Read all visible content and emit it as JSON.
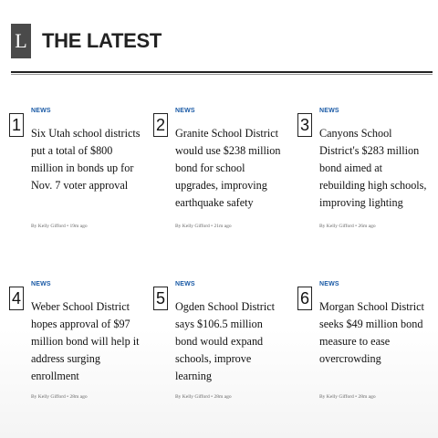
{
  "header": {
    "logo_letter": "L",
    "title": "THE LATEST"
  },
  "articles": [
    {
      "number": "1",
      "category": "NEWS",
      "headline": "Six Utah school districts put a total of $800 million in bonds up for Nov. 7 voter approval",
      "author": "By Kelly Gifford",
      "age": "19m ago"
    },
    {
      "number": "2",
      "category": "NEWS",
      "headline": "Granite School District would use $238 million bond for school upgrades, improving earthquake safety",
      "author": "By Kelly Gifford",
      "age": "21m ago"
    },
    {
      "number": "3",
      "category": "NEWS",
      "headline": "Canyons School District's $283 million bond aimed at rebuilding high schools, improving lighting",
      "author": "By Kelly Gifford",
      "age": "26m ago"
    },
    {
      "number": "4",
      "category": "NEWS",
      "headline": "Weber School District hopes approval of $97 million bond will help it address surging enrollment",
      "author": "By Kelly Gifford",
      "age": "28m ago"
    },
    {
      "number": "5",
      "category": "NEWS",
      "headline": "Ogden School District says $106.5 million bond would expand schools, improve learning",
      "author": "By Kelly Gifford",
      "age": "28m ago"
    },
    {
      "number": "6",
      "category": "NEWS",
      "headline": "Morgan School District seeks $49 million bond measure to ease overcrowding",
      "author": "By Kelly Gifford",
      "age": "28m ago"
    }
  ]
}
